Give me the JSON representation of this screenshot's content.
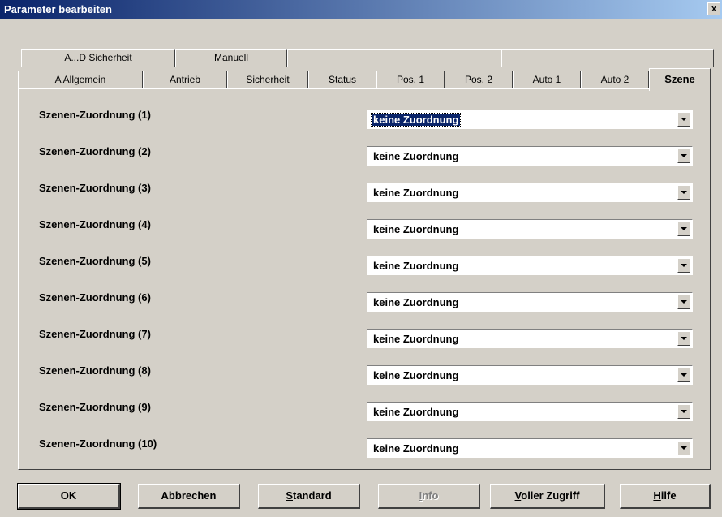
{
  "window": {
    "title": "Parameter bearbeiten",
    "close": "x"
  },
  "tabs_row1": [
    "A...D  Sicherheit",
    "Manuell"
  ],
  "tabs_row2": [
    "A  Allgemein",
    "Antrieb",
    "Sicherheit",
    "Status",
    "Pos. 1",
    "Pos. 2",
    "Auto 1",
    "Auto 2",
    "Szene"
  ],
  "active_tab": "Szene",
  "rows": [
    {
      "label": "Szenen-Zuordnung (1)",
      "value": "keine Zuordnung"
    },
    {
      "label": "Szenen-Zuordnung (2)",
      "value": "keine Zuordnung"
    },
    {
      "label": "Szenen-Zuordnung (3)",
      "value": "keine Zuordnung"
    },
    {
      "label": "Szenen-Zuordnung (4)",
      "value": "keine Zuordnung"
    },
    {
      "label": "Szenen-Zuordnung (5)",
      "value": "keine Zuordnung"
    },
    {
      "label": "Szenen-Zuordnung (6)",
      "value": "keine Zuordnung"
    },
    {
      "label": "Szenen-Zuordnung (7)",
      "value": "keine Zuordnung"
    },
    {
      "label": "Szenen-Zuordnung (8)",
      "value": "keine Zuordnung"
    },
    {
      "label": "Szenen-Zuordnung (9)",
      "value": "keine Zuordnung"
    },
    {
      "label": "Szenen-Zuordnung (10)",
      "value": "keine Zuordnung"
    }
  ],
  "buttons": {
    "ok": "OK",
    "abbrechen": "Abbrechen",
    "standard_first": "S",
    "standard_rest": "tandard",
    "info_first": "I",
    "info_rest": "nfo",
    "voller_first": "V",
    "voller_rest": "oller Zugriff",
    "hilfe_first": "H",
    "hilfe_rest": "ilfe"
  },
  "colors": {
    "titlebar": "#0a246a",
    "face": "#d4d0c8",
    "highlight": "#0a246a"
  }
}
